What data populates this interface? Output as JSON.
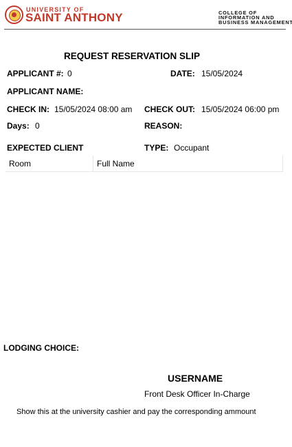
{
  "header": {
    "university_line1": "UNIVERSITY OF",
    "university_line2": "SAINT ANTHONY",
    "college_line1": "COLLEGE OF",
    "college_line2": "INFORMATION AND",
    "college_line3": "BUSINESS MANAGEMENT"
  },
  "slip": {
    "title": "REQUEST RESERVATION SLIP",
    "applicant_no_label": "APPLICANT #:",
    "applicant_no_value": "0",
    "date_label": "DATE:",
    "date_value": "15/05/2024",
    "applicant_name_label": "APPLICANT NAME:",
    "applicant_name_value": "",
    "check_in_label": "CHECK IN:",
    "check_in_value": "15/05/2024 08:00 am",
    "check_out_label": "CHECK OUT:",
    "check_out_value": "15/05/2024 06:00 pm",
    "days_label": "Days:",
    "days_value": "0",
    "reason_label": "REASON:",
    "reason_value": "",
    "expected_client_label": "EXPECTED CLIENT",
    "type_label": "TYPE:",
    "type_value": "Occupant"
  },
  "client_table": {
    "columns": [
      "Room",
      "Full Name"
    ],
    "rows": []
  },
  "footer": {
    "lodging_choice_label": "LODGING CHOICE:",
    "username": "USERNAME",
    "officer_role": "Front Desk Officer In-Charge",
    "note": "Show this at the university cashier and pay the corresponding ammount"
  },
  "colors": {
    "brand_red": "#c0392b",
    "seal_gold": "#f2c94c"
  }
}
